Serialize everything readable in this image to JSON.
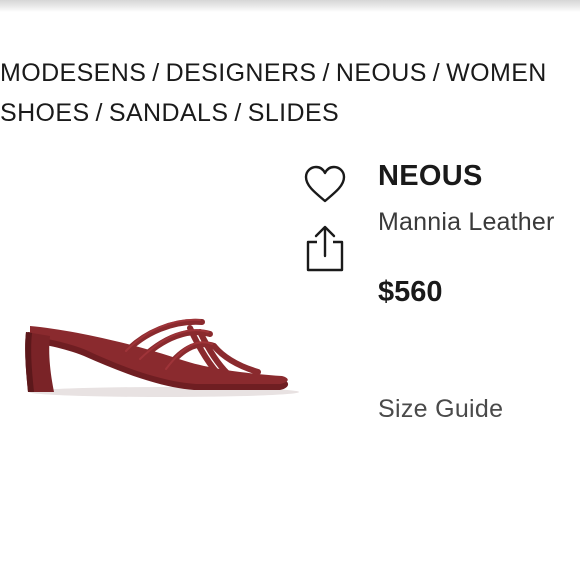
{
  "breadcrumb": {
    "line1": [
      {
        "label": "MODESENS"
      },
      {
        "label": "DESIGNERS"
      },
      {
        "label": "NEOUS"
      },
      {
        "label": "WOMEN"
      }
    ],
    "line2": [
      {
        "label": "SHOES"
      },
      {
        "label": "SANDALS"
      },
      {
        "label": "SLIDES"
      }
    ],
    "separator": "/"
  },
  "actions": {
    "favorite_icon": "heart-icon",
    "share_icon": "share-icon"
  },
  "product": {
    "brand": "NEOUS",
    "name": "Mannia Leather",
    "price": "$560",
    "image_color": "#8a2a2e"
  },
  "links": {
    "size_guide": "Size Guide"
  }
}
